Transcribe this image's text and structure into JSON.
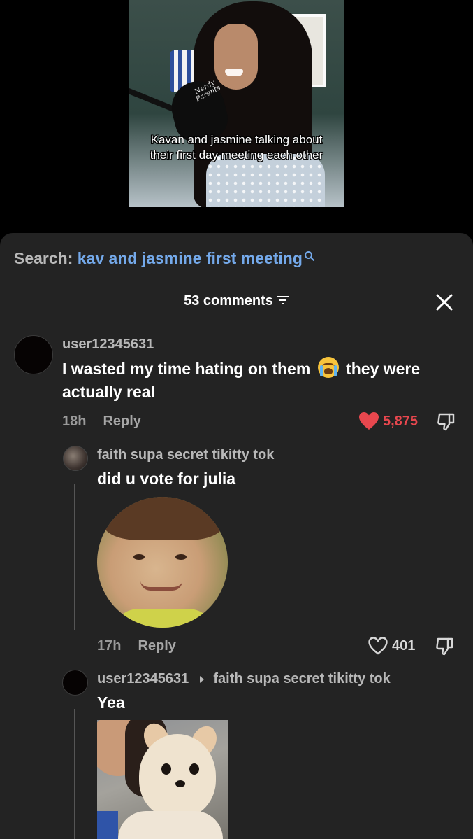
{
  "video": {
    "caption": "Kavan and jasmine talking about their first day meeting each other",
    "mic_logo": "Nerdy Parents"
  },
  "search": {
    "prefix": "Search:",
    "query": "kav and jasmine first meeting"
  },
  "comments_header": {
    "count_label": "53 comments"
  },
  "colors": {
    "accent_link": "#74a9ea",
    "liked_heart": "#e8474e",
    "sheet_bg": "#232323"
  },
  "comments": [
    {
      "username": "user12345631",
      "text_before_emoji": "I wasted my time hating on them",
      "emoji": "loudly-crying-face",
      "text_after_emoji": "they were actually real",
      "time": "18h",
      "reply_label": "Reply",
      "likes": "5,875",
      "liked": true
    },
    {
      "username": "faith supa secret tikitty tok",
      "text": "did u vote for julia",
      "media": "gif-sticker",
      "time": "17h",
      "reply_label": "Reply",
      "likes": "401",
      "liked": false
    },
    {
      "username": "user12345631",
      "reply_to": "faith supa secret tikitty tok",
      "text": "Yea",
      "media": "photo"
    }
  ]
}
